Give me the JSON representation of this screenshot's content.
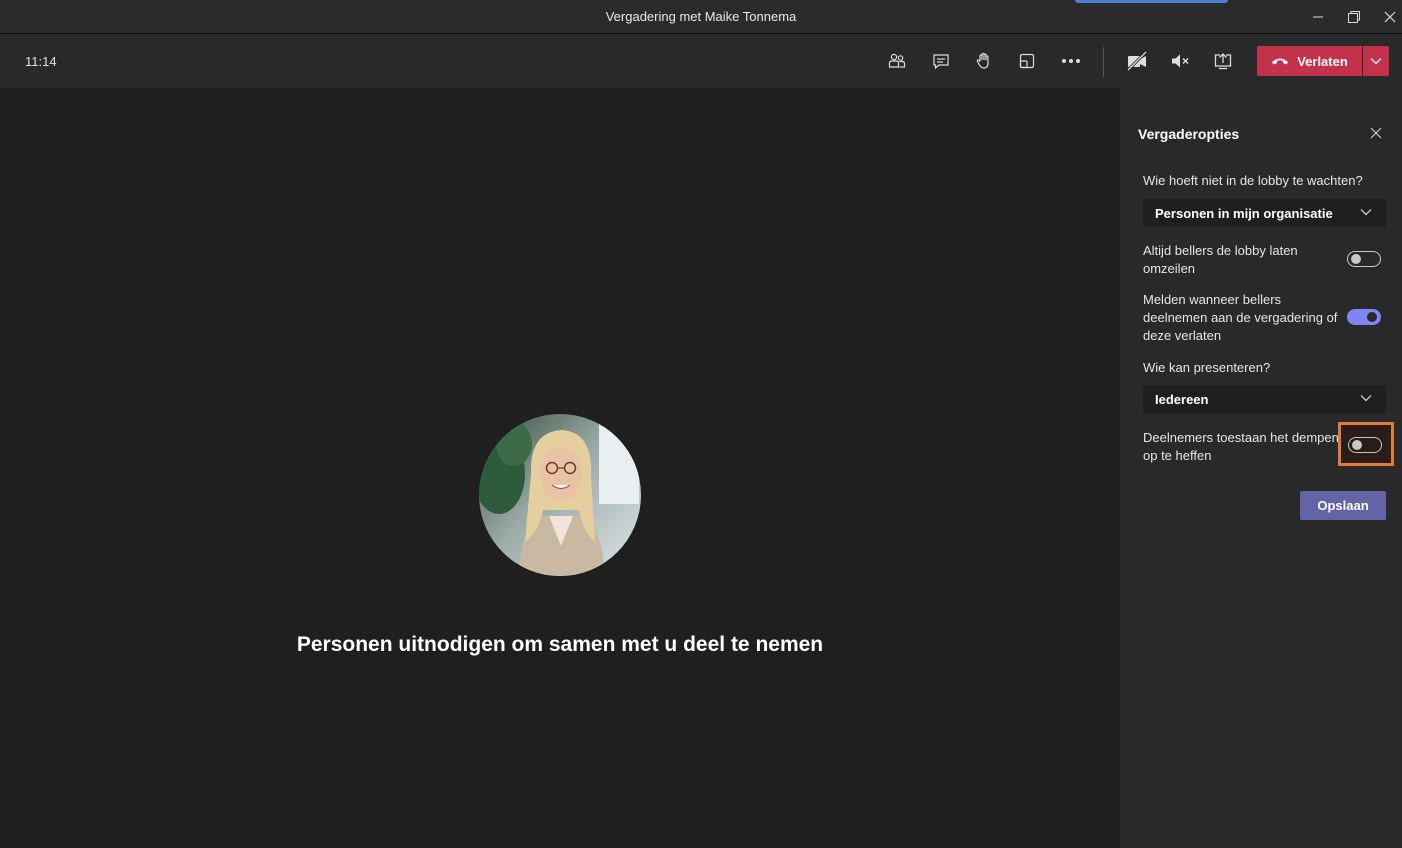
{
  "window": {
    "title": "Vergadering met Maike Tonnema"
  },
  "toolbar": {
    "time": "11:14",
    "leave_label": "Verlaten"
  },
  "stage": {
    "invite_text": "Personen uitnodigen om samen met u deel te nemen"
  },
  "panel": {
    "title": "Vergaderopties",
    "lobby_question": "Wie hoeft niet in de lobby te wachten?",
    "lobby_value": "Personen in mijn organisatie",
    "bypass_label_1": "Altijd bellers de lobby laten",
    "bypass_label_2": "omzeilen",
    "bypass_on": false,
    "announce_label_1": "Melden wanneer bellers",
    "announce_label_2": "deelnemen aan de vergadering of",
    "announce_label_3": "deze verlaten",
    "announce_on": true,
    "present_question": "Wie kan presenteren?",
    "present_value": "Iedereen",
    "unmute_label_1": "Deelnemers toestaan het dempen",
    "unmute_label_2": "op te heffen",
    "unmute_on": false,
    "save_label": "Opslaan"
  },
  "colors": {
    "leave": "#c4314b",
    "accent": "#6264a7",
    "toggle_on": "#7f85f5",
    "highlight": "#e07b39"
  }
}
